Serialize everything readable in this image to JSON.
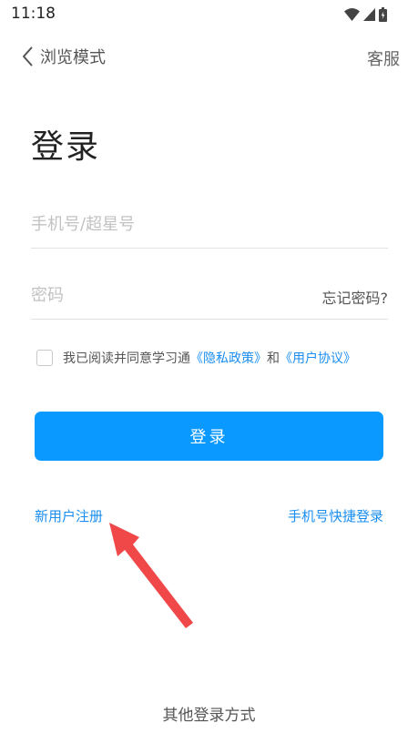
{
  "status_bar": {
    "time": "11:18",
    "icons": [
      "wifi-icon",
      "cell-signal-icon",
      "battery-icon"
    ]
  },
  "top_bar": {
    "back_label": "浏览模式",
    "service_label": "客服"
  },
  "page_title": "登录",
  "form": {
    "phone_placeholder": "手机号/超星号",
    "phone_value": "",
    "password_placeholder": "密码",
    "password_value": "",
    "forgot_label": "忘记密码?"
  },
  "agreement": {
    "checked": false,
    "prefix": "我已阅读并同意学习通",
    "privacy_label": "《隐私政策》",
    "and_label": "和",
    "user_agreement_label": "《用户协议》"
  },
  "login_button_label": "登录",
  "links": {
    "register": "新用户注册",
    "quick_login": "手机号快捷登录"
  },
  "other_login_label": "其他登录方式",
  "colors": {
    "primary": "#0a99ff",
    "link": "#1a8ef0",
    "annotation_arrow": "#f04848"
  }
}
